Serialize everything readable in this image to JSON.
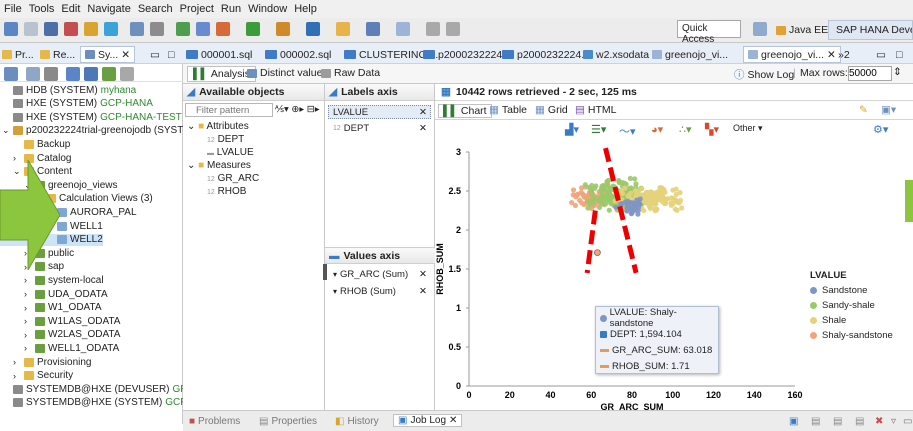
{
  "menu": [
    "File",
    "Tools",
    "Edit",
    "Navigate",
    "Search",
    "Project",
    "Run",
    "Window",
    "Help"
  ],
  "toolbar": {
    "quick_access": "Quick Access",
    "perspective_1": "Java EE",
    "perspective_2": "SAP HANA Developm"
  },
  "left_tabs": [
    "Pr...",
    "Re...",
    "Sy..."
  ],
  "editor_tabs": [
    "000001.sql",
    "000002.sql",
    "CLUSTERING ...",
    "p2000232224...",
    "p2000232224...",
    "w2.xsodata",
    "greenojo_vi...",
    "greenojo_vi...",
    "»2"
  ],
  "tree": [
    {
      "label": "HDB (SYSTEM)",
      "suffix": "myhana",
      "indent": 0
    },
    {
      "label": "HXE (SYSTEM)",
      "suffix": "GCP-HANA",
      "indent": 0
    },
    {
      "label": "HXE (SYSTEM)",
      "suffix": "GCP-HANA-TEST",
      "indent": 0
    },
    {
      "label": "p200232224trial-greenojodb (SYSTEM",
      "suffix": "",
      "indent": 0
    },
    {
      "label": "Backup",
      "suffix": "",
      "indent": 1
    },
    {
      "label": "Catalog",
      "suffix": "",
      "indent": 1
    },
    {
      "label": "Content",
      "suffix": "",
      "indent": 1
    },
    {
      "label": "greenojo_views",
      "suffix": "",
      "indent": 2
    },
    {
      "label": "Calculation Views (3)",
      "suffix": "",
      "indent": 3
    },
    {
      "label": "AURORA_PAL",
      "suffix": "",
      "indent": 4
    },
    {
      "label": "WELL1",
      "suffix": "",
      "indent": 4
    },
    {
      "label": "WELL2",
      "suffix": "",
      "indent": 4
    },
    {
      "label": "public",
      "suffix": "",
      "indent": 2
    },
    {
      "label": "sap",
      "suffix": "",
      "indent": 2
    },
    {
      "label": "system-local",
      "suffix": "",
      "indent": 2
    },
    {
      "label": "UDA_ODATA",
      "suffix": "",
      "indent": 2
    },
    {
      "label": "W1_ODATA",
      "suffix": "",
      "indent": 2
    },
    {
      "label": "W1LAS_ODATA",
      "suffix": "",
      "indent": 2
    },
    {
      "label": "W2LAS_ODATA",
      "suffix": "",
      "indent": 2
    },
    {
      "label": "WELL1_ODATA",
      "suffix": "",
      "indent": 2
    },
    {
      "label": "Provisioning",
      "suffix": "",
      "indent": 1
    },
    {
      "label": "Security",
      "suffix": "",
      "indent": 1
    },
    {
      "label": "SYSTEMDB@HXE (DEVUSER)",
      "suffix": "GREENO",
      "indent": 0
    },
    {
      "label": "SYSTEMDB@HXE (SYSTEM)",
      "suffix": "GCP-Gree",
      "indent": 0
    }
  ],
  "subtabs": {
    "analysis": "Analysis",
    "distinct": "Distinct values",
    "raw": "Raw Data",
    "show_log": "Show Log",
    "max_rows_label": "Max rows:",
    "max_rows_value": "50000"
  },
  "available": {
    "title": "Available objects",
    "filter_placeholder": "Filter pattern",
    "attributes": "Attributes",
    "attr_items": [
      "DEPT",
      "LVALUE"
    ],
    "measures": "Measures",
    "measure_items": [
      "GR_ARC",
      "RHOB"
    ]
  },
  "labels_axis": {
    "title": "Labels axis",
    "items": [
      "LVALUE",
      "DEPT"
    ]
  },
  "values_axis": {
    "title": "Values axis",
    "items": [
      "GR_ARC (Sum)",
      "RHOB (Sum)"
    ]
  },
  "result": {
    "status": "10442 rows retrieved - 2 sec, 125 ms",
    "view_tabs": [
      "Chart",
      "Table",
      "Grid",
      "HTML"
    ],
    "other": "Other"
  },
  "chart_data": {
    "type": "scatter",
    "xlabel": "GR_ARC_SUM",
    "ylabel": "RHOB_SUM",
    "xlim": [
      0,
      160
    ],
    "ylim": [
      0,
      3
    ],
    "x_ticks": [
      "0",
      "20",
      "40",
      "60",
      "80",
      "100",
      "120",
      "140",
      "160"
    ],
    "y_ticks": [
      "0",
      "0.5",
      "1",
      "1.5",
      "2",
      "2.5",
      "3"
    ],
    "legend_title": "LVALUE",
    "legend_position": "right",
    "series": [
      {
        "name": "Sandstone",
        "color": "#7f95c4"
      },
      {
        "name": "Sandy-shale",
        "color": "#9ac96a"
      },
      {
        "name": "Shale",
        "color": "#e6d27a"
      },
      {
        "name": "Shaly-sandstone",
        "color": "#f0a478"
      }
    ],
    "tooltip": {
      "lvalue": "LVALUE: Shaly-sandstone",
      "dept": "DEPT: 1,594.104",
      "gr": "GR_ARC_SUM: 63.018",
      "rhob": "RHOB_SUM: 1.71"
    }
  },
  "bottom_tabs": [
    "Problems",
    "Properties",
    "History",
    "Job Log"
  ]
}
